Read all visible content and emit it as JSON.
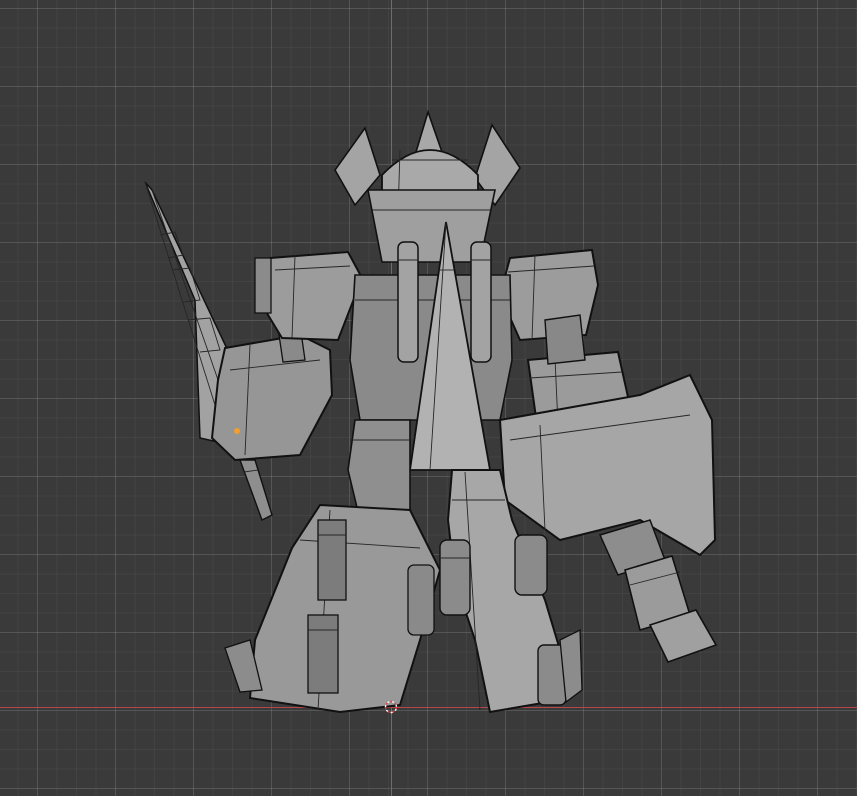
{
  "viewport": {
    "background_color": "#393939",
    "grid_color": "#4a4a4a",
    "axis_x_color": "#b5464c",
    "axis_z_color": "#4a70b8",
    "mesh_color": "#9a9a9a",
    "wire_color": "#262626",
    "selection_color": "#f0a030",
    "icons": [
      "3d-cursor-icon",
      "origin-point-icon"
    ]
  }
}
